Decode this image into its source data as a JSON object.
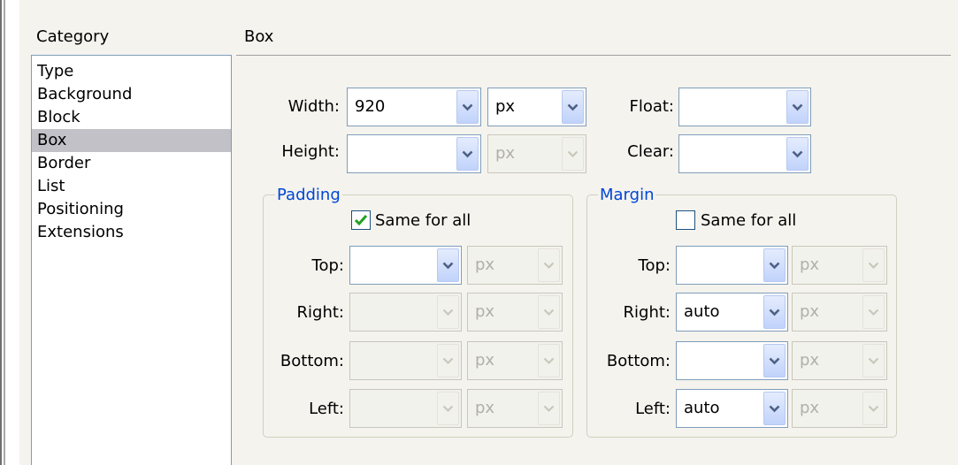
{
  "category": {
    "header": "Category",
    "items": [
      "Type",
      "Background",
      "Block",
      "Box",
      "Border",
      "List",
      "Positioning",
      "Extensions"
    ],
    "selected_index": 3
  },
  "section_title": "Box",
  "width": {
    "label": "Width:",
    "value": "920",
    "unit": "px"
  },
  "height": {
    "label": "Height:",
    "value": "",
    "unit": "px"
  },
  "float": {
    "label": "Float:",
    "value": ""
  },
  "clear": {
    "label": "Clear:",
    "value": ""
  },
  "padding": {
    "legend": "Padding",
    "same_for_all_label": "Same for all",
    "same_for_all_checked": true,
    "top": {
      "label": "Top:",
      "value": "",
      "unit": "px"
    },
    "right": {
      "label": "Right:",
      "value": "",
      "unit": "px"
    },
    "bottom": {
      "label": "Bottom:",
      "value": "",
      "unit": "px"
    },
    "left": {
      "label": "Left:",
      "value": "",
      "unit": "px"
    }
  },
  "margin": {
    "legend": "Margin",
    "same_for_all_label": "Same for all",
    "same_for_all_checked": false,
    "top": {
      "label": "Top:",
      "value": "",
      "unit": "px"
    },
    "right": {
      "label": "Right:",
      "value": "auto",
      "unit": "px"
    },
    "bottom": {
      "label": "Bottom:",
      "value": "",
      "unit": "px"
    },
    "left": {
      "label": "Left:",
      "value": "auto",
      "unit": "px"
    }
  },
  "colors": {
    "legend": "#0046d5",
    "selected_bg": "#c1c1c7",
    "checkmark": "#21a121"
  }
}
